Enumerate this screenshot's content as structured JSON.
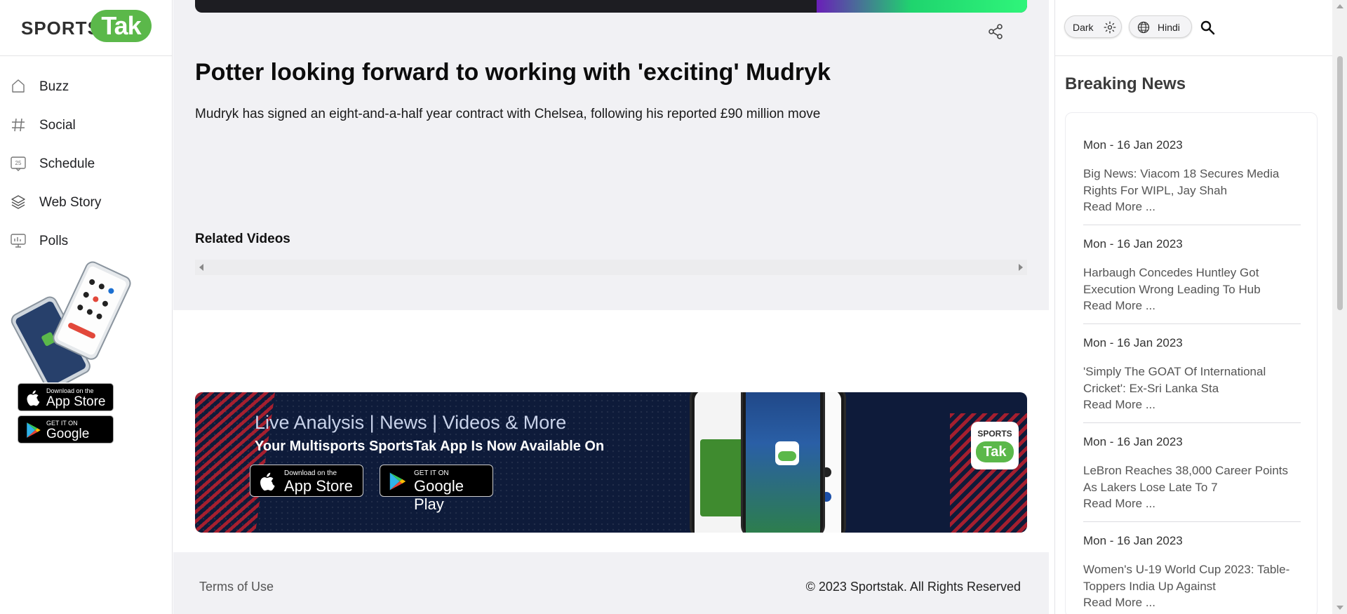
{
  "brand": {
    "logo_sports": "SPORTS",
    "logo_tak": "Tak",
    "brand_green": "#5bb84a"
  },
  "sidebar": {
    "items": [
      {
        "label": "Buzz",
        "icon": "home-icon"
      },
      {
        "label": "Social",
        "icon": "hashtag-icon"
      },
      {
        "label": "Schedule",
        "icon": "calendar-icon"
      },
      {
        "label": "Web Story",
        "icon": "layers-icon"
      },
      {
        "label": "Polls",
        "icon": "poll-icon"
      }
    ],
    "calendar_badge": "25",
    "app_store": {
      "small": "Download on the",
      "big": "App Store"
    },
    "google_play": {
      "small": "GET IT ON",
      "big": "Google Play"
    }
  },
  "article": {
    "title": "Potter looking forward to working with 'exciting' Mudryk",
    "description": "Mudryk has signed an eight-and-a-half year contract with Chelsea, following his reported £90 million move",
    "related_videos_title": "Related Videos"
  },
  "banner": {
    "line1": "Live Analysis | News | Videos & More",
    "line2": "Your Multisports SportsTak App Is Now Available On",
    "app_store": {
      "small": "Download on the",
      "big": "App Store"
    },
    "google_play": {
      "small": "GET IT ON",
      "big": "Google Play"
    },
    "logo_sports": "SPORTS",
    "logo_tak": "Tak"
  },
  "footer": {
    "terms": "Terms of Use",
    "copyright": "© 2023 Sportstak. All Rights Reserved"
  },
  "topbar": {
    "theme_label": "Dark",
    "language_label": "Hindi"
  },
  "breaking_news": {
    "title": "Breaking News",
    "read_more": "Read More ...",
    "items": [
      {
        "date": "Mon - 16 Jan 2023",
        "headline": "Big News: Viacom 18 Secures Media Rights For WIPL, Jay Shah"
      },
      {
        "date": "Mon - 16 Jan 2023",
        "headline": "Harbaugh Concedes Huntley Got Execution Wrong Leading To Hub"
      },
      {
        "date": "Mon - 16 Jan 2023",
        "headline": "'Simply The GOAT Of International Cricket': Ex-Sri Lanka Sta"
      },
      {
        "date": "Mon - 16 Jan 2023",
        "headline": "LeBron Reaches 38,000 Career Points As Lakers Lose Late To 7"
      },
      {
        "date": "Mon - 16 Jan 2023",
        "headline": "Women's U-19 World Cup 2023: Table-Toppers India Up Against"
      }
    ]
  }
}
